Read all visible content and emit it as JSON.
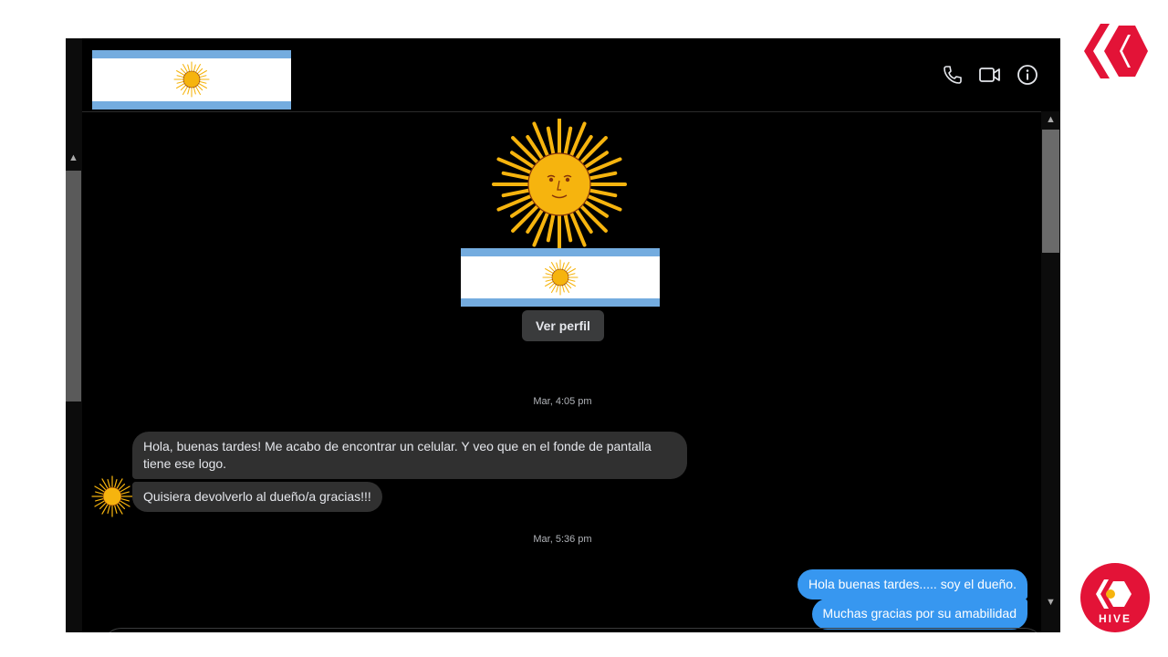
{
  "header": {
    "icons": [
      "phone-icon",
      "video-icon",
      "info-icon"
    ]
  },
  "profile": {
    "button_label": "Ver perfil"
  },
  "messages": {
    "ts1": "Mar, 4:05 pm",
    "m1": "Hola, buenas tardes! Me acabo de encontrar un celular. Y veo que en el fonde de pantalla tiene ese logo.",
    "m2": "Quisiera devolverlo al dueño/a gracias!!!",
    "ts2": "Mar, 5:36 pm",
    "m3": "Hola buenas tardes..... soy el dueño.",
    "m4": "Muchas gracias por su amabilidad"
  },
  "branding": {
    "badge_text": "HIVE"
  },
  "colors": {
    "accent": "#3797f0",
    "hive_red": "#e31337",
    "flag_blue": "#74acdf",
    "sun": "#f6b40e"
  }
}
